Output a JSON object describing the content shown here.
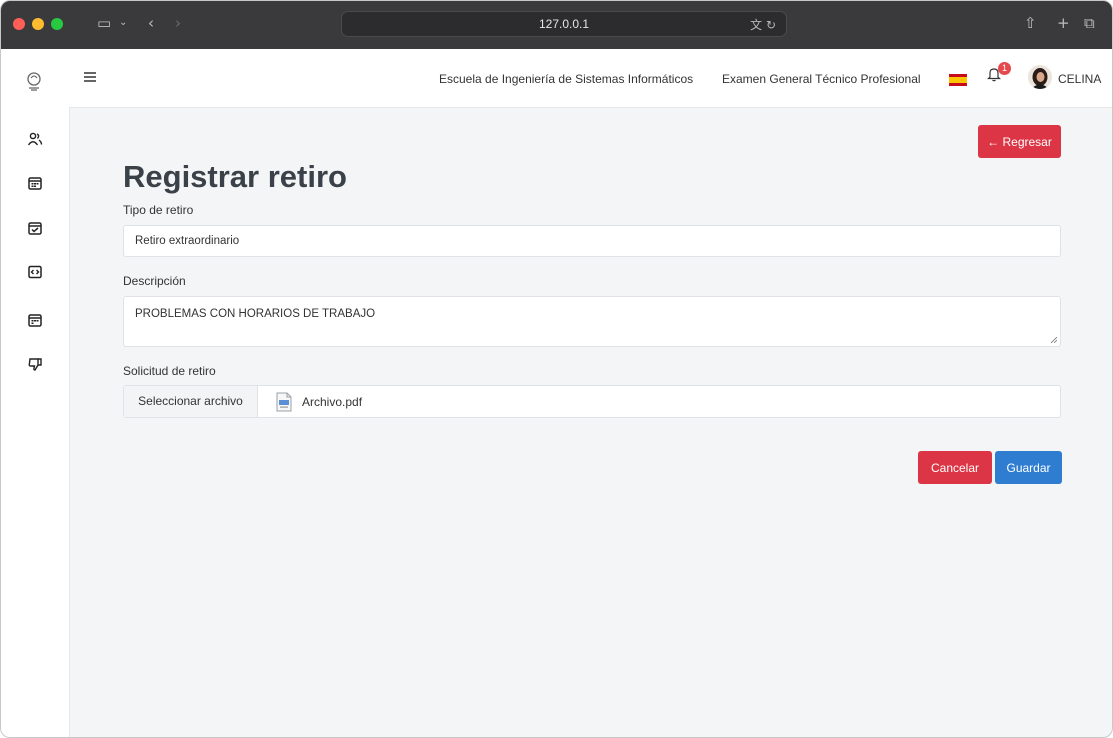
{
  "browser": {
    "url": "127.0.0.1"
  },
  "header": {
    "school": "Escuela de Ingeniería de Sistemas Informáticos",
    "exam": "Examen General Técnico Profesional",
    "notifications_count": "1",
    "user_name": "CELINA"
  },
  "sidebar": {
    "items": [
      {
        "icon": "users-icon"
      },
      {
        "icon": "calendar-icon"
      },
      {
        "icon": "calendar-check-icon"
      },
      {
        "icon": "code-icon"
      },
      {
        "icon": "calendar-icon"
      },
      {
        "icon": "thumbs-down-icon"
      }
    ]
  },
  "page": {
    "back_label": "← Regresar",
    "title": "Registrar retiro",
    "tipo_label": "Tipo de retiro",
    "tipo_value": "Retiro extraordinario",
    "descripcion_label": "Descripción",
    "descripcion_value": "PROBLEMAS CON HORARIOS DE TRABAJO",
    "solicitud_label": "Solicitud de retiro",
    "file_button": "Seleccionar archivo",
    "file_name": "Archivo.pdf",
    "cancel_label": "Cancelar",
    "save_label": "Guardar"
  },
  "colors": {
    "danger": "#dc3545",
    "primary": "#2e7dd1",
    "background": "#f4f5f7"
  }
}
